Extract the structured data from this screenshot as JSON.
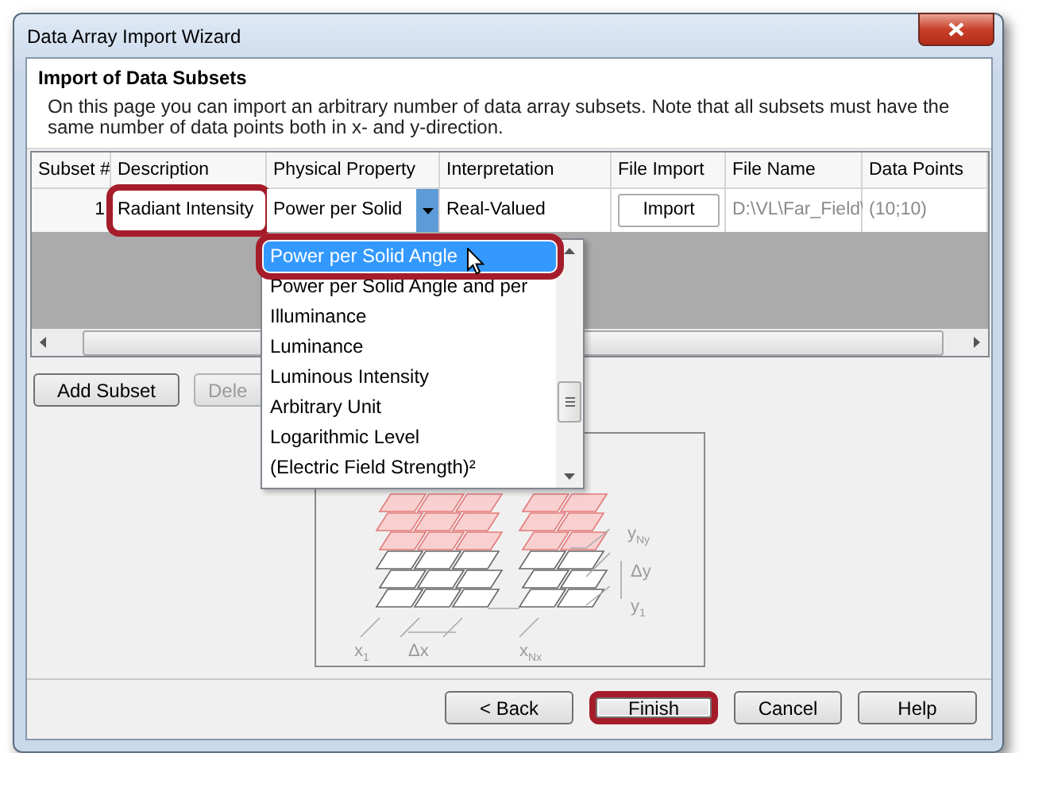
{
  "window": {
    "title": "Data Array Import Wizard"
  },
  "header": {
    "title": "Import of Data Subsets",
    "description": "On this page you can import an arbitrary number of data array subsets. Note that all subsets must have the same number of data points both in x- and y-direction."
  },
  "table": {
    "columns": [
      "Subset #",
      "Description",
      "Physical Property",
      "Interpretation",
      "File Import",
      "File Name",
      "Data Points"
    ],
    "rows": [
      {
        "subset": "1",
        "description": "Radiant Intensity",
        "description_highlighted": true,
        "physical_property": "Power per Solid",
        "interpretation": "Real-Valued",
        "file_import": "Import",
        "file_name": "D:\\VL\\Far_Field\\",
        "data_points": "(10;10)"
      }
    ]
  },
  "dropdown": {
    "items": [
      {
        "label": "Power per Solid Angle",
        "selected": true,
        "highlighted": true
      },
      {
        "label": "Power per Solid Angle and per",
        "selected": false,
        "highlighted": false
      },
      {
        "label": "Illuminance",
        "selected": false,
        "highlighted": false
      },
      {
        "label": "Luminance",
        "selected": false,
        "highlighted": false
      },
      {
        "label": "Luminous Intensity",
        "selected": false,
        "highlighted": false
      },
      {
        "label": "Arbitrary Unit",
        "selected": false,
        "highlighted": false
      },
      {
        "label": "Logarithmic Level",
        "selected": false,
        "highlighted": false
      },
      {
        "label": "(Electric Field Strength)²",
        "selected": false,
        "highlighted": false
      }
    ]
  },
  "subset_buttons": [
    {
      "label": "Add Subset",
      "disabled": false
    },
    {
      "label": "Dele",
      "disabled": true
    }
  ],
  "diagram": {
    "labels": [
      {
        "base": "x",
        "sub": "1"
      },
      {
        "base": "Δx"
      },
      {
        "base": "x",
        "sub": "Nx"
      },
      {
        "base": "y",
        "sub": "Ny"
      },
      {
        "base": "Δy"
      },
      {
        "base": "y",
        "sub": "1"
      }
    ]
  },
  "buttons": [
    {
      "label": "< Back",
      "highlighted": false
    },
    {
      "label": "Finish",
      "highlighted": true
    },
    {
      "label": "Cancel",
      "highlighted": false
    },
    {
      "label": "Help",
      "highlighted": false
    }
  ]
}
